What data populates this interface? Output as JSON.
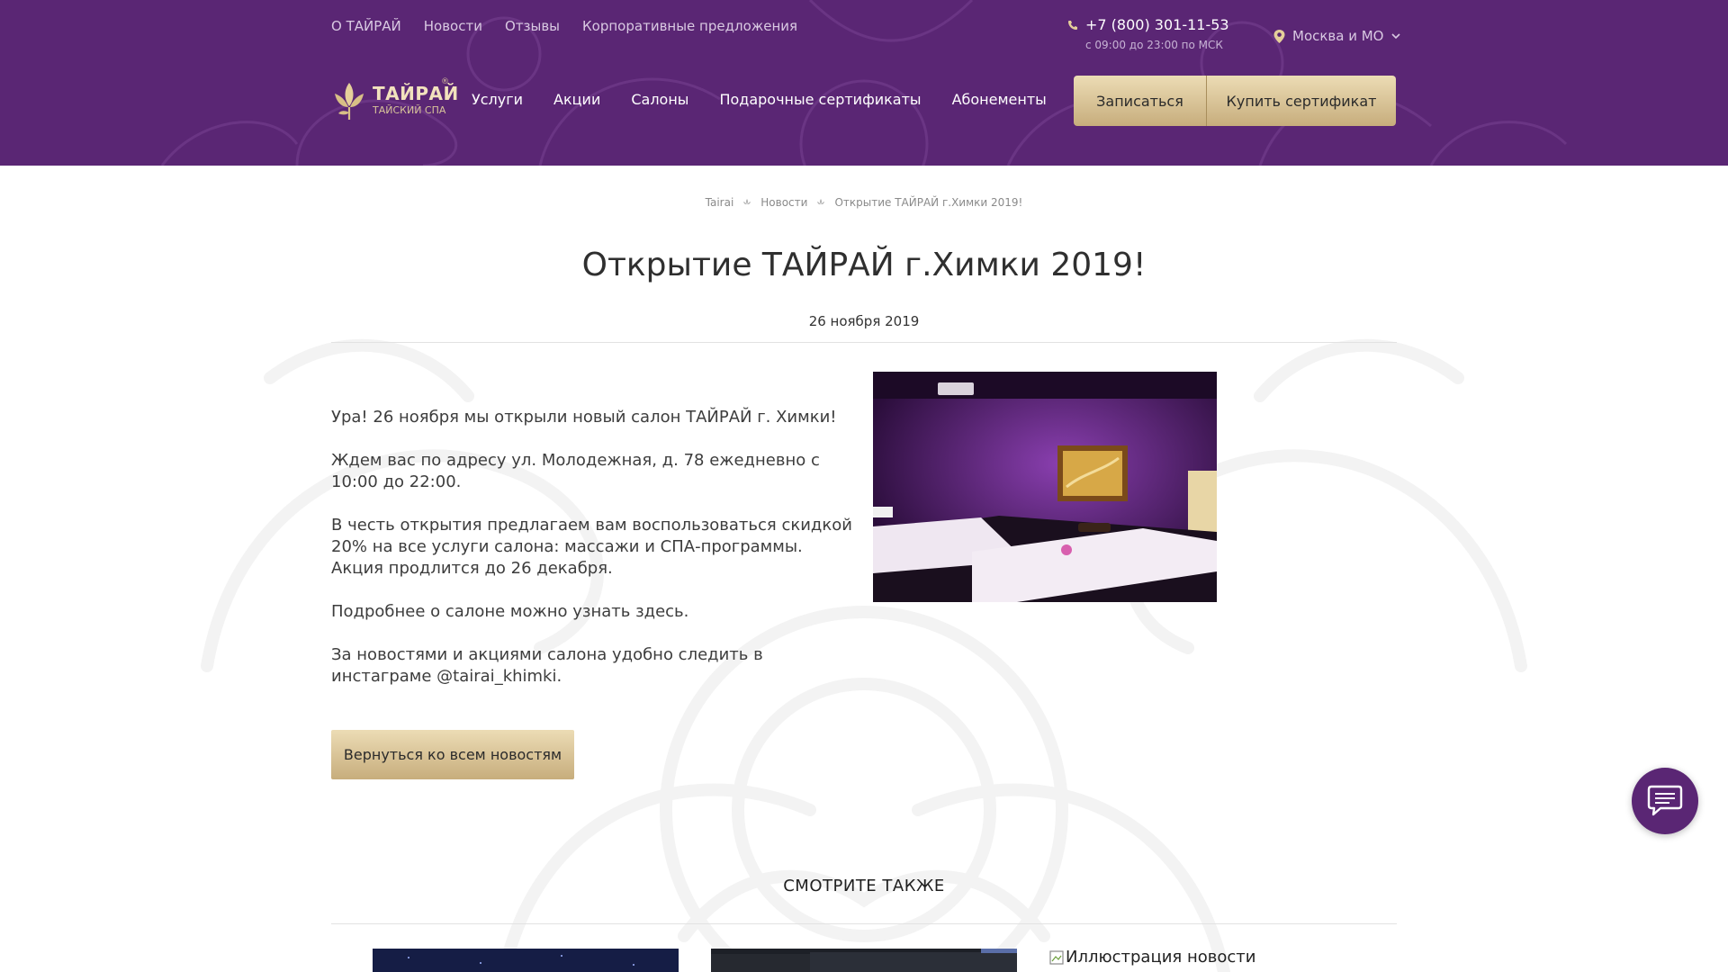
{
  "header": {
    "top_links": [
      "О ТАЙРАЙ",
      "Новости",
      "Отзывы",
      "Корпоративные предложения"
    ],
    "phone": "+7 (800) 301-11-53",
    "hours": "с 09:00 до 23:00 по МСК",
    "region": "Москва и МО",
    "logo": {
      "name": "ТАЙРАЙ",
      "subtitle": "ТАЙСКИЙ СПА",
      "reg": "®"
    },
    "nav": [
      "Услуги",
      "Акции",
      "Салоны",
      "Подарочные сертификаты",
      "Абонементы"
    ],
    "book_button": "Записаться",
    "cert_button": "Купить сертификат"
  },
  "breadcrumb": [
    "Tairai",
    "Новости",
    "Открытие ТАЙРАЙ г.Химки 2019!"
  ],
  "article": {
    "title": "Открытие ТАЙРАЙ г.Химки 2019!",
    "date": "26 ноября 2019",
    "paragraphs": [
      "Ура! 26 ноября мы открыли новый салон ТАЙРАЙ г. Химки!",
      "Ждем вас по адресу ул. Молодежная, д. 78 ежедневно с 10:00 до 22:00.",
      "В честь открытия предлагаем вам воспользоваться скидкой 20% на все услуги салона: массажи и СПА-программы. Акция продлится до 26 декабря.",
      "Подробнее о салоне можно узнать здесь.",
      "За новостями и акциями салона удобно следить в инстаграме @tairai_khimki."
    ],
    "back_button": "Вернуться ко всем новостям"
  },
  "see_also": {
    "title": "СМОТРИТЕ ТАКЖЕ",
    "broken_image_alt": "Иллюстрация новости"
  },
  "colors": {
    "header_bg": "#5a2674",
    "gold_light": "#ecdcb5",
    "gold_dark": "#c7ad7c",
    "chat_bg": "#5a2674"
  },
  "icons": {
    "phone": "phone-icon",
    "region": "location-pin-icon",
    "dropdown": "chevron-down-icon",
    "breadcrumb_separator": "lotus-separator-icon",
    "chat": "chat-bubble-icon"
  }
}
